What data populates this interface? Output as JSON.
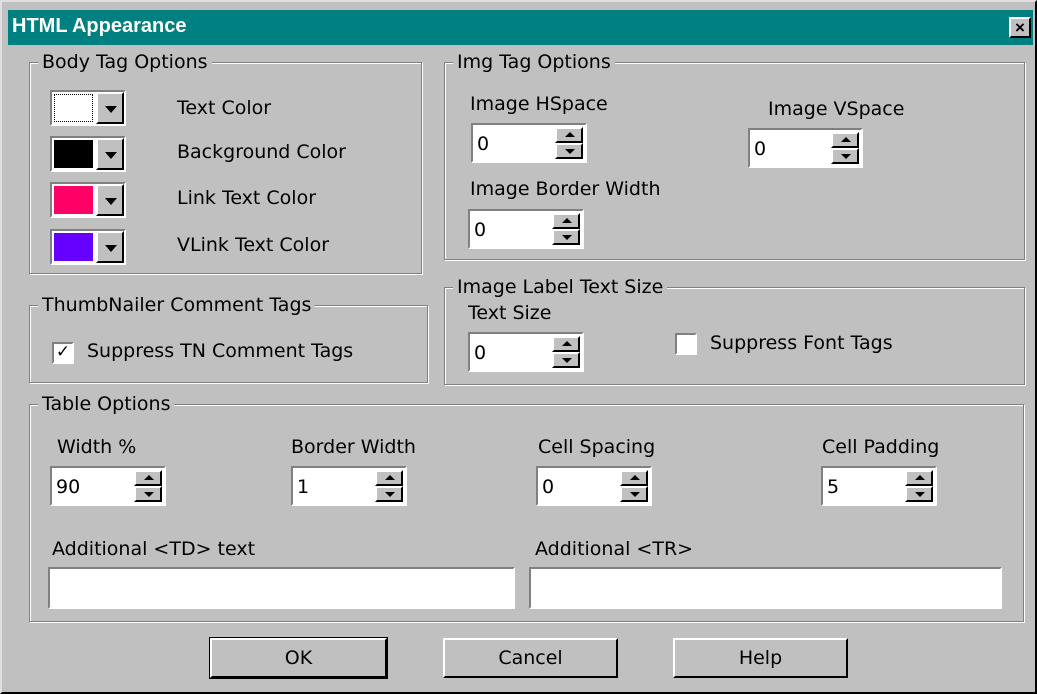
{
  "window": {
    "title": "HTML Appearance",
    "close_glyph": "×"
  },
  "body_tag": {
    "legend": "Body Tag Options",
    "colors": [
      {
        "label": "Text Color",
        "swatch": "#ffffff"
      },
      {
        "label": "Background Color",
        "swatch": "#000000"
      },
      {
        "label": "Link Text Color",
        "swatch": "#ff0066"
      },
      {
        "label": "VLink Text Color",
        "swatch": "#6600ff"
      }
    ]
  },
  "img_tag": {
    "legend": "Img Tag Options",
    "hspace_label": "Image HSpace",
    "hspace_value": "0",
    "vspace_label": "Image VSpace",
    "vspace_value": "0",
    "border_label": "Image Border Width",
    "border_value": "0"
  },
  "thumbnailer": {
    "legend": "ThumbNailer Comment Tags",
    "suppress_label": "Suppress TN Comment Tags",
    "suppress_checked": "✓"
  },
  "image_label": {
    "legend": "Image Label Text Size",
    "text_size_label": "Text Size",
    "text_size_value": "0",
    "suppress_font_label": "Suppress Font Tags",
    "suppress_font_checked": ""
  },
  "table": {
    "legend": "Table Options",
    "width_label": "Width %",
    "width_value": "90",
    "border_label": "Border Width",
    "border_value": "1",
    "spacing_label": "Cell Spacing",
    "spacing_value": "0",
    "padding_label": "Cell Padding",
    "padding_value": "5",
    "td_label": "Additional <TD> text",
    "td_value": "",
    "tr_label": "Additional <TR>",
    "tr_value": ""
  },
  "buttons": {
    "ok": "OK",
    "cancel": "Cancel",
    "help": "Help"
  }
}
